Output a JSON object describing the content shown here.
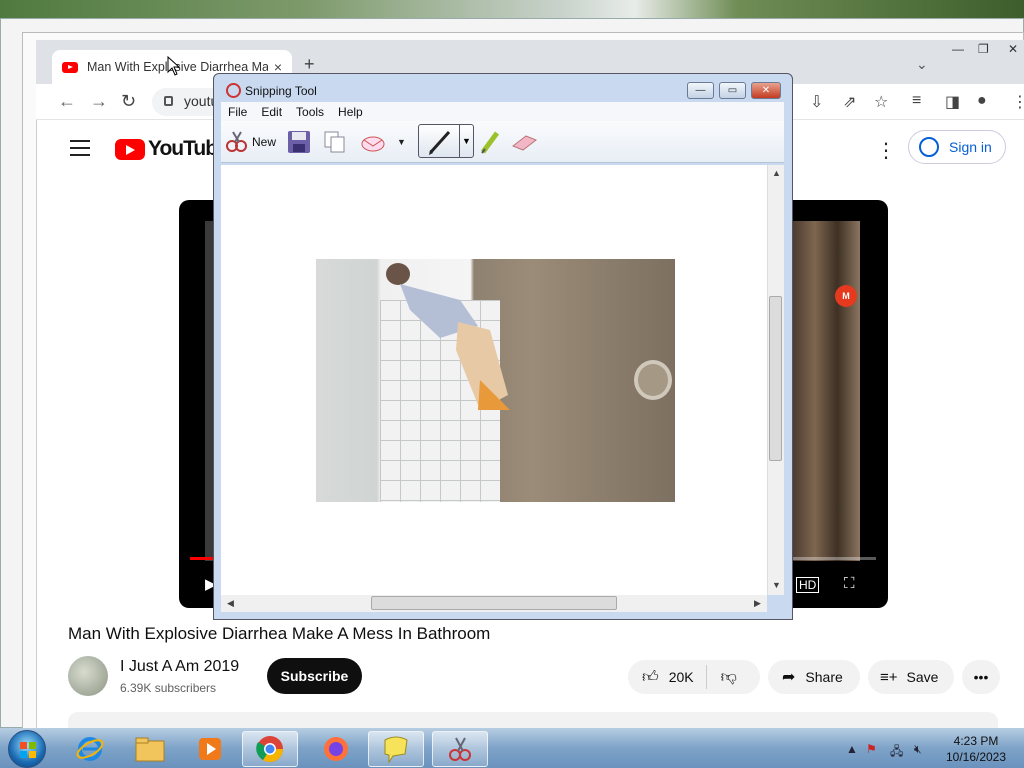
{
  "browser": {
    "tab_title": "Man With Explosive Diarrhea Make A Mess In Bathroom - YouTube",
    "new_tab": "+",
    "tab_close": "×",
    "url": "youtube.com",
    "window_buttons": [
      "—",
      "❐",
      "✕"
    ]
  },
  "youtube": {
    "logo_text": "YouTube",
    "sign_in": "Sign in",
    "video_title": "Man With Explosive Diarrhea Make A Mess In Bathroom",
    "channel_name": "I Just A Am 2019",
    "subscribers": "6.39K subscribers",
    "subscribe": "Subscribe",
    "likes": "20K",
    "share": "Share",
    "save": "Save",
    "more": "•••",
    "watermark": "M"
  },
  "snipping_tool": {
    "title": "Snipping Tool",
    "menu": [
      "File",
      "Edit",
      "Tools",
      "Help"
    ],
    "new_label": "New",
    "buttons": {
      "minimize": "—",
      "maximize": "▭",
      "close": "✕"
    }
  },
  "taskbar": {
    "time": "4:23 PM",
    "date": "10/16/2023",
    "apps": [
      "internet-explorer",
      "file-explorer",
      "media-player",
      "chrome",
      "firefox",
      "sticky-notes",
      "snipping-tool"
    ]
  },
  "colors": {
    "youtube_red": "#ff0000",
    "link_blue": "#065fd4",
    "snip_frame": "#c9daf0"
  }
}
